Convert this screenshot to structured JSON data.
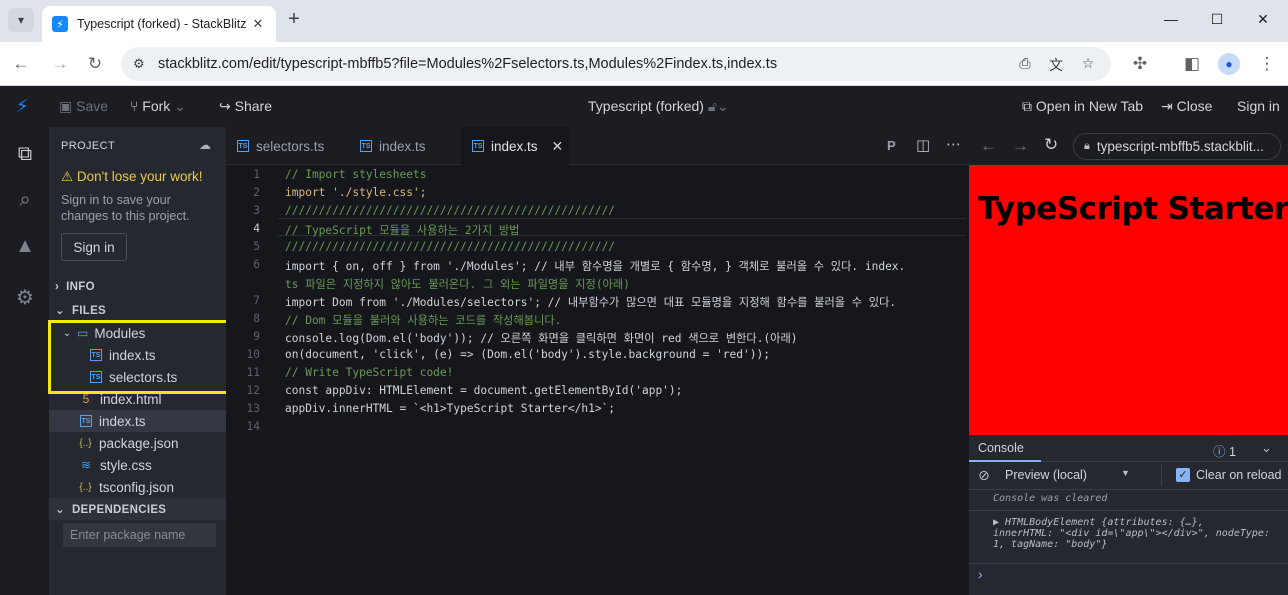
{
  "browser": {
    "tab_title": "Typescript (forked) - StackBlitz",
    "url": "stackblitz.com/edit/typescript-mbffb5?file=Modules%2Fselectors.ts,Modules%2Findex.ts,index.ts"
  },
  "header": {
    "save": "Save",
    "fork": "Fork",
    "share": "Share",
    "project_title": "Typescript (forked)",
    "open_new_tab": "Open in New Tab",
    "close": "Close",
    "sign_in": "Sign in"
  },
  "sidebar": {
    "project_label": "PROJECT",
    "warning": "Don't lose your work!",
    "warning_text": "Sign in to save your changes to this project.",
    "sign_in_button": "Sign in",
    "info_label": "INFO",
    "files_label": "FILES",
    "folder": "Modules",
    "module_files": [
      "index.ts",
      "selectors.ts"
    ],
    "files": [
      "index.html",
      "index.ts",
      "package.json",
      "style.css",
      "tsconfig.json"
    ],
    "dependencies_label": "DEPENDENCIES",
    "package_placeholder": "Enter package name"
  },
  "editor": {
    "tabs": [
      "selectors.ts",
      "index.ts",
      "index.ts"
    ],
    "active_tab": 2,
    "line_numbers": [
      "1",
      "2",
      "3",
      "4",
      "5",
      "6",
      "",
      "7",
      "8",
      "9",
      "10",
      "11",
      "12",
      "13",
      "14"
    ],
    "lines": [
      "// Import stylesheets",
      "import './style.css';",
      "/////////////////////////////////////////////////",
      "// TypeScript 모듈을 사용하는 2가지 방법",
      "/////////////////////////////////////////////////",
      "import { on, off } from './Modules'; // 내부 함수명을 개별로 { 함수명, } 객체로 불러올 수 있다. index.",
      "ts 파일은 지정하지 않아도 불러온다. 그 외는 파일명을 지정(아래)",
      "import Dom from './Modules/selectors'; // 내부함수가 많으면 대표 모듈명을 지정해 함수를 불러올 수 있다.",
      "// Dom 모듈을 불러와 사용하는 코드를 작성해봅니다.",
      "console.log(Dom.el('body')); // 오른쪽 화면을 클릭하면 화면이 red 색으로 변한다.(아래)",
      "on(document, 'click', (e) => (Dom.el('body').style.background = 'red'));",
      "// Write TypeScript code!",
      "const appDiv: HTMLElement = document.getElementById('app');",
      "appDiv.innerHTML = `<h1>TypeScript Starter</h1>`;",
      ""
    ]
  },
  "preview": {
    "url": "typescript-mbffb5.stackblit...",
    "heading": "TypeScript Starter",
    "background": "#ff0000"
  },
  "console": {
    "tab": "Console",
    "issues": "1",
    "context": "Preview (local)",
    "clear_label": "Clear on reload",
    "cleared": "Console was cleared",
    "log_line1": "▶ HTMLBodyElement {attributes: {…},",
    "log_line2": "innerHTML: \"<div id=\\\"app\\\"></div>\", nodeType:",
    "log_line3": "1, tagName: \"body\"}",
    "prompt": "›"
  }
}
